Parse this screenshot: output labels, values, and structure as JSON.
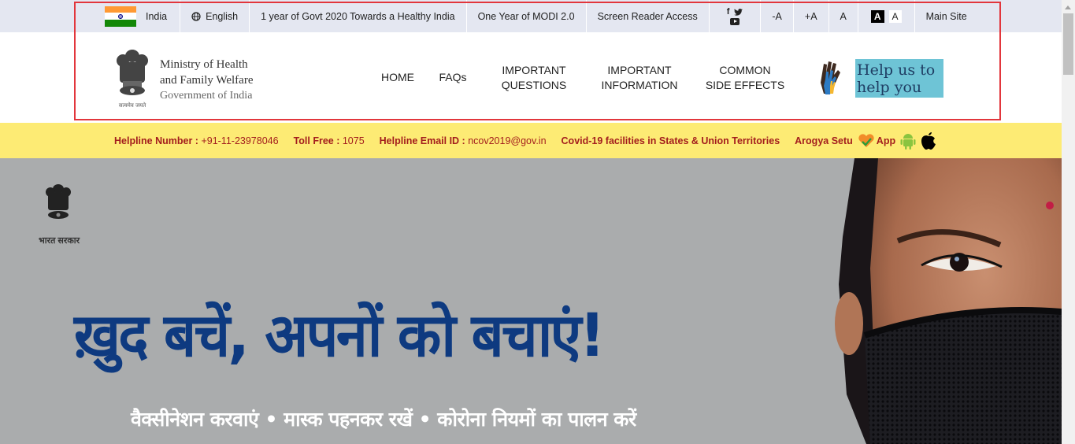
{
  "topbar": {
    "country": "India",
    "language": "English",
    "links": [
      "1 year of Govt 2020 Towards a Healthy India",
      "One Year of MODI 2.0",
      "Screen Reader Access"
    ],
    "social": [
      "facebook",
      "twitter",
      "youtube"
    ],
    "font_controls": [
      "-A",
      "+A",
      "A"
    ],
    "contrast": {
      "dark": "A",
      "light": "A"
    },
    "main_site": "Main Site"
  },
  "header": {
    "ministry_line1": "Ministry of Health",
    "ministry_line2": "and Family Welfare",
    "govt": "Government of India",
    "emblem_motto": "सत्यमेव जयते",
    "nav": [
      {
        "line1": "HOME",
        "line2": ""
      },
      {
        "line1": "FAQs",
        "line2": ""
      },
      {
        "line1": "IMPORTANT",
        "line2": "QUESTIONS"
      },
      {
        "line1": "IMPORTANT",
        "line2": "INFORMATION"
      },
      {
        "line1": "COMMON",
        "line2": "SIDE EFFECTS"
      }
    ],
    "help_banner": {
      "line1": "Help us to",
      "line2": "help you"
    }
  },
  "helpline": {
    "number_label": "Helpline Number :",
    "number_value": " +91-11-23978046",
    "tollfree_label": "Toll Free :",
    "tollfree_value": " 1075",
    "email_label": "Helpline Email ID :",
    "email_value": " ncov2019@gov.in",
    "facilities_link": "Covid-19 facilities in States & Union Territories",
    "arogya_label": "Arogya Setu",
    "app_label": "App"
  },
  "hero": {
    "govt_label": "भारत सरकार",
    "title": "ख़ुद बचें, अपनों को बचाएं!",
    "subtitle": "वैक्सीनेशन करवाएं  •  मास्क पहनकर रखें  •  कोरोना नियमों का पालन करें"
  },
  "colors": {
    "topbar_bg": "#e4e7f1",
    "helpline_bg": "#fdeb74",
    "helpline_text": "#a31d1d",
    "hero_bg": "#aaacad",
    "hero_title": "#0e3a80",
    "highlight_border": "#e2363c"
  }
}
